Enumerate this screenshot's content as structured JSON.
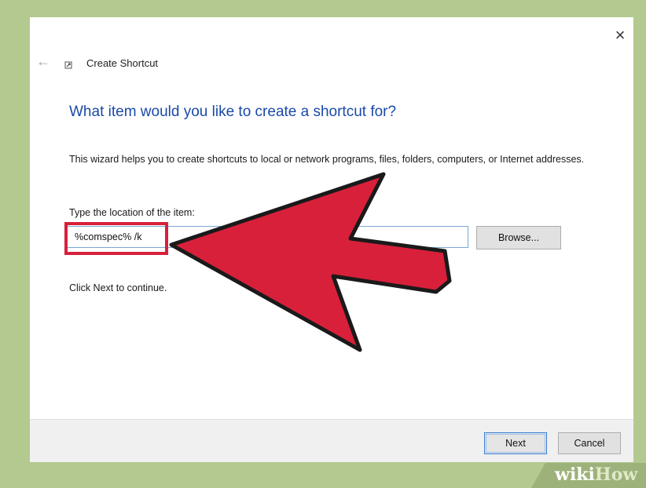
{
  "window": {
    "title": "Create Shortcut",
    "close_glyph": "×",
    "back_glyph": "←",
    "icons": [
      "close-icon",
      "back-arrow-icon",
      "shortcut-icon"
    ]
  },
  "main": {
    "heading": "What item would you like to create a shortcut for?",
    "description": "This wizard helps you to create shortcuts to local or network programs, files, folders, computers, or Internet addresses.",
    "field_label": "Type the location of the item:",
    "location_value": "%comspec% /k",
    "browse_label": "Browse...",
    "continue_text": "Click Next to continue."
  },
  "footer": {
    "next_label": "Next",
    "cancel_label": "Cancel"
  },
  "annotation": {
    "highlight_color": "#d8203a",
    "arrow_color": "#d8203a"
  },
  "watermark": {
    "wiki": "wiki",
    "how": "How"
  },
  "colors": {
    "frame": "#b3c98f",
    "heading": "#1a4aa8",
    "input_border": "#7aa7d6"
  }
}
